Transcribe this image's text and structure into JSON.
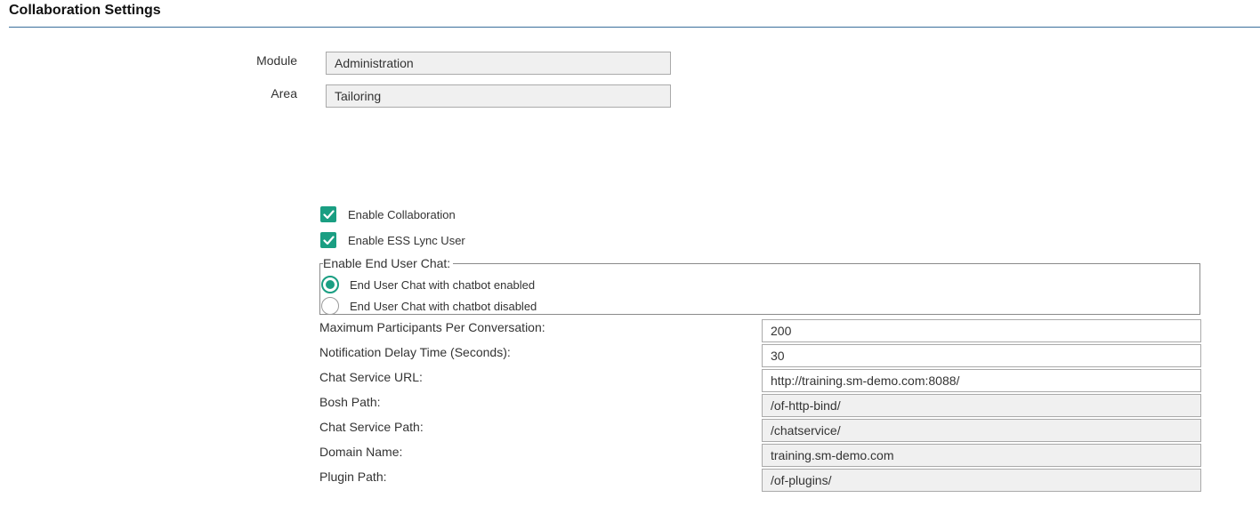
{
  "page": {
    "title": "Collaboration Settings"
  },
  "header_fields": {
    "module": {
      "label": "Module",
      "value": "Administration"
    },
    "area": {
      "label": "Area",
      "value": "Tailoring"
    }
  },
  "checkboxes": {
    "enable_collaboration": {
      "label": "Enable Collaboration",
      "checked": true
    },
    "enable_ess_lync_user": {
      "label": "Enable ESS Lync User",
      "checked": true
    }
  },
  "end_user_chat": {
    "legend": "Enable End User Chat:",
    "options": [
      {
        "label": "End User Chat with chatbot enabled",
        "selected": true
      },
      {
        "label": "End User Chat with chatbot disabled",
        "selected": false
      }
    ]
  },
  "settings": {
    "max_participants": {
      "label": "Maximum Participants Per Conversation:",
      "value": "200",
      "editable": true
    },
    "notification_delay": {
      "label": "Notification Delay Time (Seconds):",
      "value": "30",
      "editable": true
    },
    "chat_service_url": {
      "label": "Chat Service URL:",
      "value": "http://training.sm-demo.com:8088/",
      "editable": true
    },
    "bosh_path": {
      "label": "Bosh Path:",
      "value": "/of-http-bind/",
      "editable": false
    },
    "chat_service_path": {
      "label": "Chat Service Path:",
      "value": "/chatservice/",
      "editable": false
    },
    "domain_name": {
      "label": "Domain Name:",
      "value": "training.sm-demo.com",
      "editable": false
    },
    "plugin_path": {
      "label": "Plugin Path:",
      "value": "/of-plugins/",
      "editable": false
    }
  },
  "colors": {
    "accent": "#1a9e82",
    "title_rule": "#3a6f9b",
    "readonly_bg": "#f0f0f0"
  },
  "icons": {
    "checkbox": "checkmark-icon"
  }
}
